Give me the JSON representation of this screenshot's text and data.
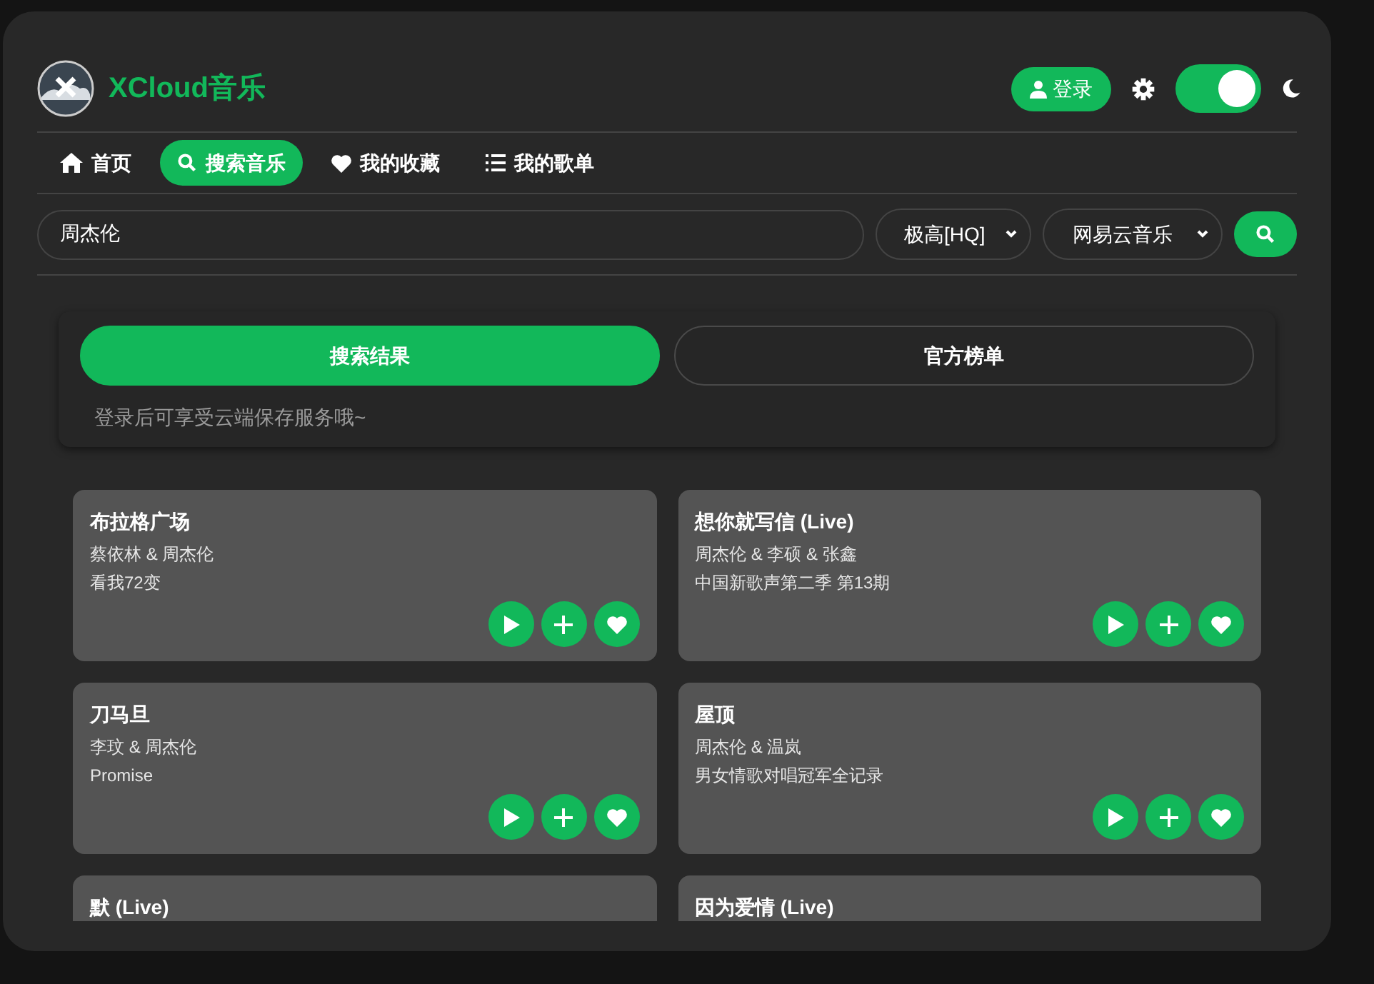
{
  "brand": {
    "title": "XCloud音乐"
  },
  "header": {
    "login": "登录",
    "dark_mode": {
      "on": true
    }
  },
  "nav": [
    {
      "label": "首页",
      "selected": false
    },
    {
      "label": "搜索音乐",
      "selected": true
    },
    {
      "label": "我的收藏",
      "selected": false
    },
    {
      "label": "我的歌单",
      "selected": false
    }
  ],
  "search": {
    "value": "周杰伦",
    "quality": "极高[HQ]",
    "source": "网易云音乐"
  },
  "result_tabs": [
    {
      "label": "搜索结果",
      "selected": true
    },
    {
      "label": "官方榜单",
      "selected": false
    }
  ],
  "notice": "登录后可享受云端保存服务哦~",
  "songs": [
    {
      "title": "布拉格广场",
      "artists": "蔡依林 & 周杰伦",
      "album": "看我72变"
    },
    {
      "title": "想你就写信 (Live)",
      "artists": "周杰伦 & 李硕 & 张鑫",
      "album": "中国新歌声第二季 第13期"
    },
    {
      "title": "刀马旦",
      "artists": "李玟 & 周杰伦",
      "album": "Promise"
    },
    {
      "title": "屋顶",
      "artists": "周杰伦 & 温岚",
      "album": "男女情歌对唱冠军全记录"
    },
    {
      "title": "默 (Live)"
    },
    {
      "title": "因为爱情 (Live)"
    }
  ]
}
